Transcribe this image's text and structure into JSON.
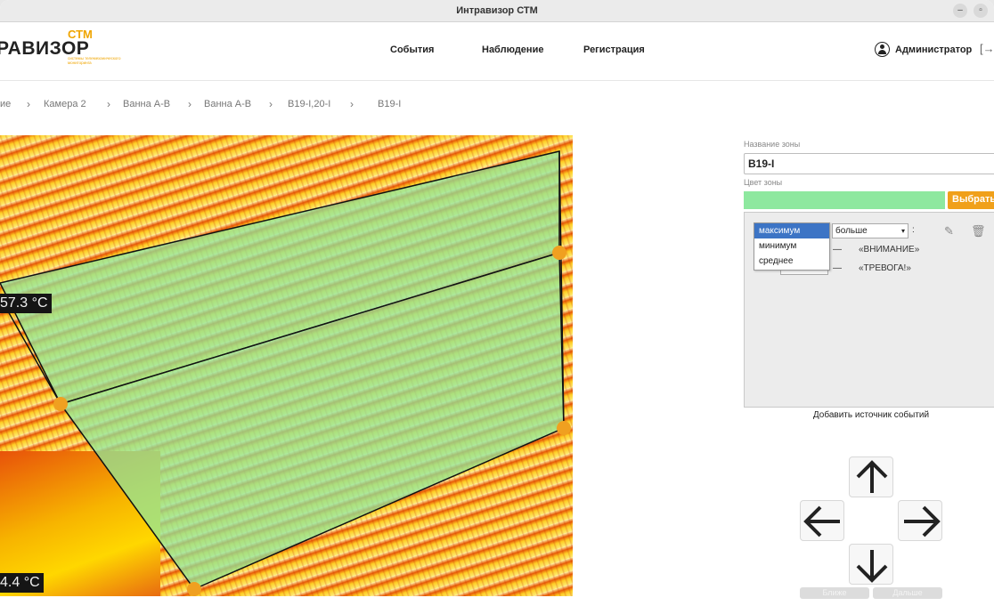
{
  "window": {
    "title": "Интравизор СТМ"
  },
  "header": {
    "logo_main": "РАВИЗОР",
    "logo_stm": "СТМ",
    "logo_sub": "системы телемеханического мониторинга",
    "nav": [
      "События",
      "Наблюдение",
      "Регистрация"
    ],
    "user": "Администратор",
    "logout_icon": "logout-icon"
  },
  "breadcrumb": [
    "ие",
    "Камера 2",
    "Ванна А-В",
    "Ванна А-В",
    "В19-I,20-I",
    "В19-I"
  ],
  "thermal": {
    "temp_max": "57.3 °C",
    "temp_min": "4.4 °C",
    "zone_fill": "#8ee89f"
  },
  "zone_form": {
    "name_label": "Название зоны",
    "name_value": "В19-I",
    "color_label": "Цвет зоны",
    "color_value": "#8ee89f",
    "choose_button": "Выбрать..."
  },
  "events": {
    "dropdown_options": [
      "максимум",
      "минимум",
      "среднее"
    ],
    "selected_option": "максимум",
    "condition": "больше",
    "colon": ":",
    "rows": [
      {
        "dash": "—",
        "label": "«ВНИМАНИЕ»"
      },
      {
        "dash": "—",
        "label": "«ТРЕВОГА!»"
      }
    ],
    "add_source": "Добавить источник событий"
  },
  "ptz": {
    "near_label": "Ближе",
    "far_label": "Дальше"
  }
}
